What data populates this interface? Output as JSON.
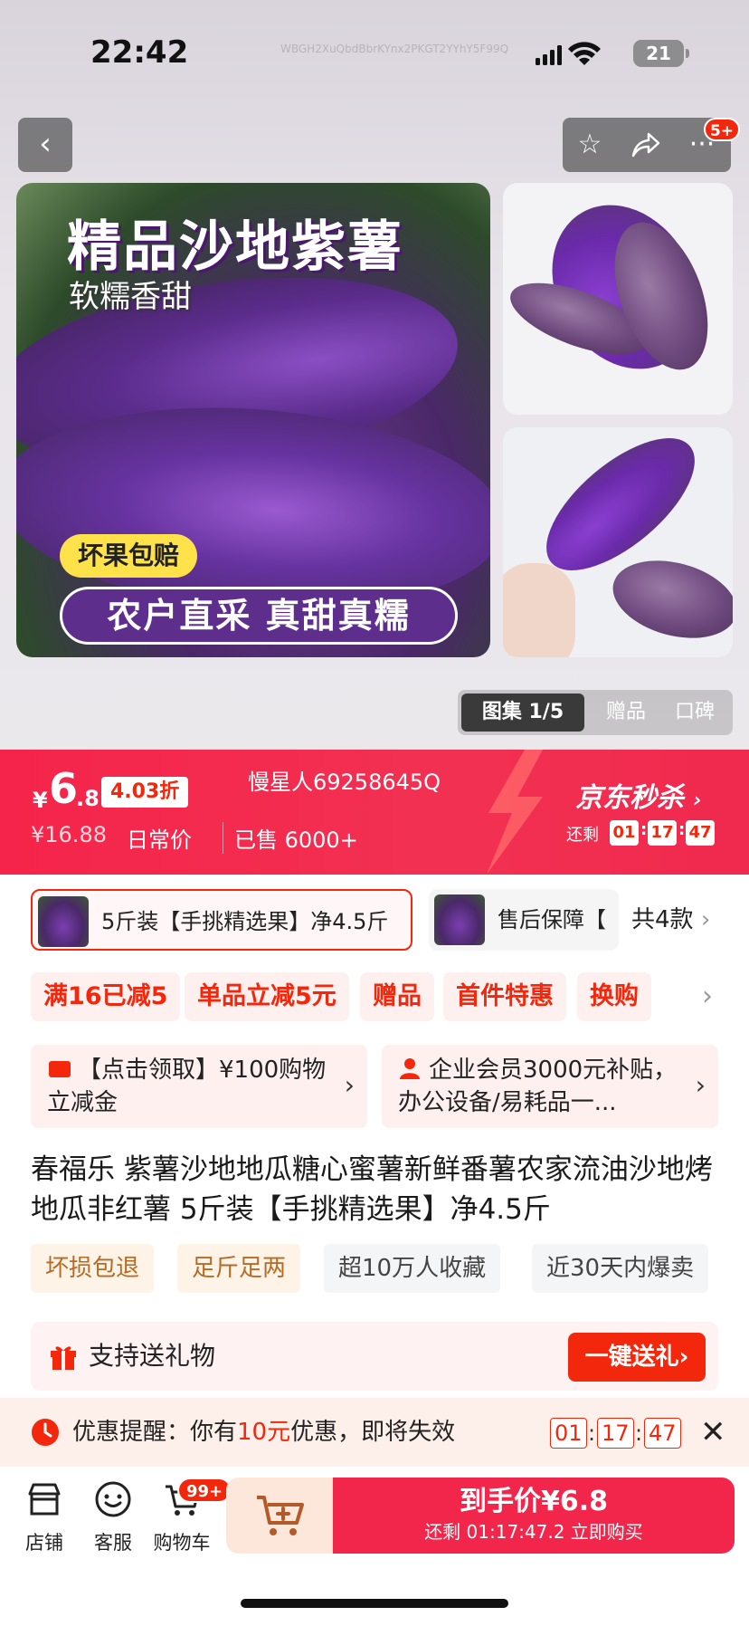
{
  "status": {
    "time": "22:42",
    "watermark": "WBGH2XuQbdBbrKYnx2PKGT2YYhY5F99Q",
    "battery": "21"
  },
  "header": {
    "back_icon": "‹",
    "more_badge": "5+"
  },
  "gallery": {
    "main_title": "精品沙地紫薯",
    "main_subtitle": "软糯香甜",
    "tag_yellow": "坏果包赔",
    "tag_purple": "农户直采 真甜真糯",
    "tabs": [
      "图集 1/5",
      "赠品",
      "口碑"
    ]
  },
  "price": {
    "currency": "¥",
    "integer": "6",
    "decimal": ".8",
    "discount": "4.03折",
    "original": "¥16.88",
    "original_label": "日常价",
    "sold": "已售 6000+",
    "user_id": "慢星人69258645Q",
    "jd_sale": "京东秒杀",
    "remaining_label": "还剩",
    "countdown": [
      "01",
      "17",
      "47"
    ]
  },
  "sku": {
    "options": [
      "5斤装【手挑精选果】净4.5斤",
      "售后保障【"
    ],
    "more": "共4款"
  },
  "coupons": {
    "chips": [
      "满16已减5",
      "单品立减5元",
      "赠品",
      "首件特惠",
      "换购"
    ],
    "card1": "【点击领取】¥100购物立减金",
    "card2": "企业会员3000元补贴，办公设备/易耗品一..."
  },
  "product": {
    "title": "春福乐 紫薯沙地地瓜糖心蜜薯新鲜番薯农家流油沙地烤地瓜非红薯 5斤装【手挑精选果】净4.5斤",
    "features": [
      "坏损包退",
      "足斤足两",
      "超10万人收藏",
      "近30天内爆卖"
    ]
  },
  "gift": {
    "label": "支持送礼物",
    "button": "一键送礼"
  },
  "reminder": {
    "prefix": "优惠提醒：你有",
    "amount": "10元",
    "suffix": "优惠，即将失效",
    "countdown": [
      "01",
      "17",
      "47"
    ]
  },
  "bottom": {
    "nav": [
      "店铺",
      "客服",
      "购物车"
    ],
    "cart_badge": "99+",
    "buy_main": "到手价¥6.8",
    "buy_sub": "还剩 01:17:47.2 立即购买"
  },
  "colors": {
    "accent": "#f2270c",
    "banner": "#f23152"
  }
}
